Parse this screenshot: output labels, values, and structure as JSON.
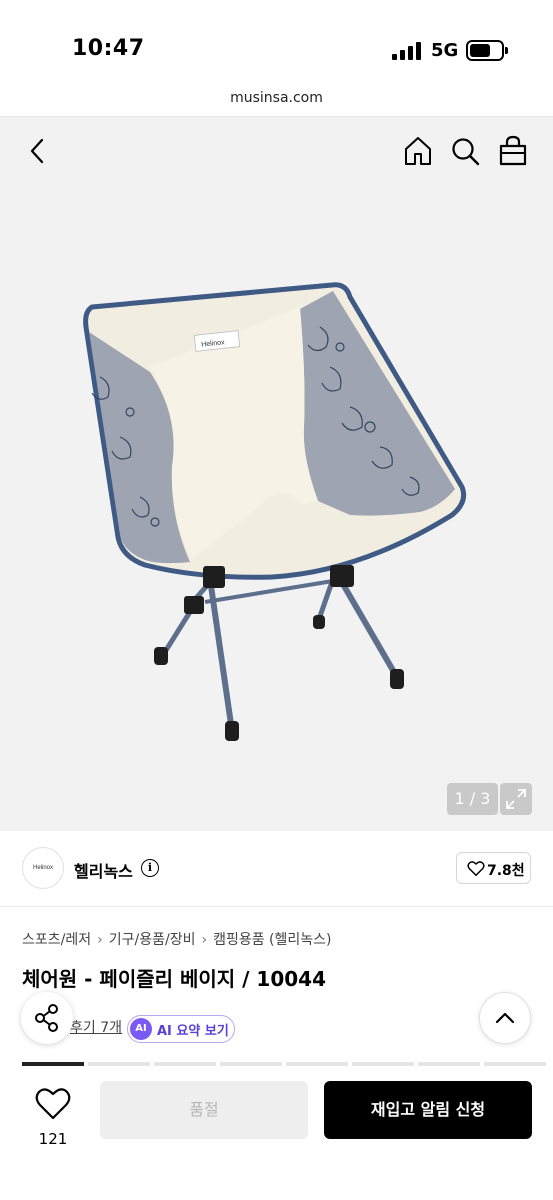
{
  "status_bar": {
    "time": "10:47",
    "network": "5G",
    "signal_icon": "signal-bars-icon",
    "battery_icon": "battery-icon"
  },
  "browser": {
    "url": "musinsa.com"
  },
  "nav": {
    "back_icon": "chevron-left-icon",
    "home_icon": "home-icon",
    "search_icon": "search-icon",
    "cart_icon": "shopping-bag-icon"
  },
  "gallery": {
    "counter": "1 / 3",
    "expand_icon": "expand-icon",
    "chair_label": "Helinox"
  },
  "brand": {
    "logo_text": "Helinox",
    "name": "헬리녹스",
    "info_icon": "info-icon",
    "likes": "7.8천"
  },
  "breadcrumb": [
    "스포츠/레저",
    "기구/용품/장비",
    "캠핑용품 (헬리녹스)"
  ],
  "product": {
    "title": "체어원 - 페이즐리 베이지 / 10044"
  },
  "reviews": {
    "link": "후기 7개",
    "ai_badge": "AI",
    "ai_summary": "AI 요약 보기"
  },
  "floating": {
    "share_icon": "share-icon",
    "top_icon": "chevron-up-icon"
  },
  "bottom": {
    "wish_count": "121",
    "soldout_label": "품절",
    "restock_label": "재입고 알림 신청"
  },
  "colors": {
    "accent_purple": "#7a5af5",
    "primary_black": "#000000",
    "disabled_gray": "#eeeeee"
  }
}
